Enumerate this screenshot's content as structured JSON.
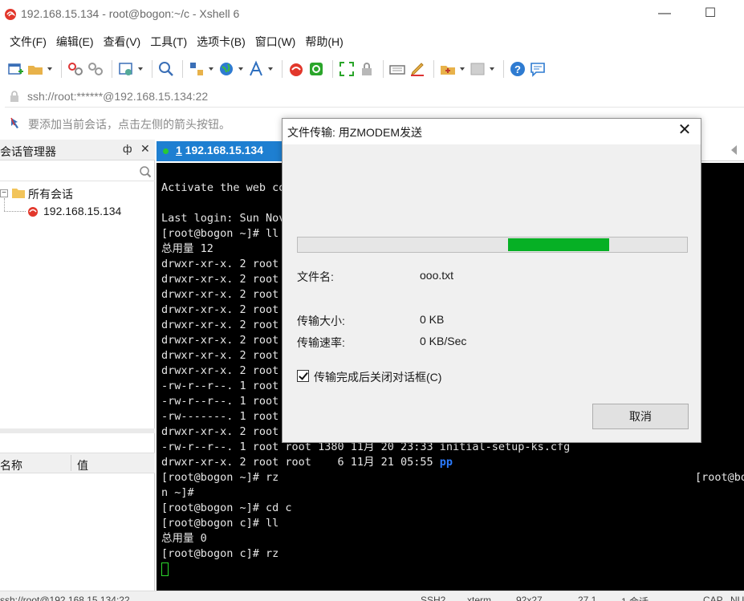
{
  "window": {
    "title": "192.168.15.134 - root@bogon:~/c - Xshell 6",
    "controls": {
      "minimize": "—",
      "maximize": "☐"
    }
  },
  "menu": [
    "文件(F)",
    "编辑(E)",
    "查看(V)",
    "工具(T)",
    "选项卡(B)",
    "窗口(W)",
    "帮助(H)"
  ],
  "toolbar_icons": [
    "new-session-icon",
    "open-folder-icon",
    "reconnect-icon",
    "disconnect-icon",
    "properties-icon",
    "find-icon",
    "transfer-icon",
    "globe-icon",
    "font-icon",
    "xftp-icon",
    "xmanager-icon",
    "fullscreen-icon",
    "lock-icon",
    "keyboard-icon",
    "highlight-icon",
    "new-tab-icon",
    "layout-icon",
    "help-icon",
    "chat-icon"
  ],
  "address": {
    "text": "ssh://root:******@192.168.15.134:22"
  },
  "hint": {
    "text": "要添加当前会话，点击左侧的箭头按钮。"
  },
  "session_manager": {
    "title": "会话管理器",
    "pin": "ф",
    "close": "✕",
    "folder": {
      "expander": "−",
      "label": "所有会话"
    },
    "session": {
      "label": "192.168.15.134"
    },
    "properties": {
      "col_name": "名称",
      "col_value": "值"
    }
  },
  "tab": {
    "number": "1",
    "label": " 192.168.15.134"
  },
  "terminal": {
    "lines": [
      "Activate the web co",
      "",
      "Last login: Sun Nov",
      "[root@bogon ~]# ll",
      "总用量 12",
      "drwxr-xr-x. 2 root",
      "drwxr-xr-x. 2 root",
      "drwxr-xr-x. 2 root",
      "drwxr-xr-x. 2 root",
      "drwxr-xr-x. 2 root",
      "drwxr-xr-x. 2 root",
      "drwxr-xr-x. 2 root",
      "drwxr-xr-x. 2 root",
      "-rw-r--r--. 1 root",
      "-rw-r--r--. 1 root",
      "-rw-------. 1 root",
      "drwxr-xr-x. 2 root",
      "-rw-r--r--. 1 root root 1380 11月 20 23:33 initial-setup-ks.cfg",
      "drwxr-xr-x. 2 root root    6 11月 21 05:55 ",
      "[root@bogon ~]# rz",
      "n ~]#",
      "[root@bogon ~]# cd c",
      "[root@bogon c]# ll",
      "总用量 0",
      "[root@bogon c]# rz"
    ],
    "dir_name": "pp",
    "right_fragment": "[root@bo"
  },
  "statusbar": {
    "left": "ssh://root@192.168.15.134:22",
    "ssh": "SSH2",
    "term": "xterm",
    "size": "92x27",
    "pos": "27,1",
    "sessions": "1 会话",
    "caps": "CAP",
    "num": "NUM"
  },
  "dialog": {
    "title": "文件传输: 用ZMODEM发送",
    "close": "✕",
    "progress_start": 0.54,
    "progress_end": 0.8,
    "filename_label": "文件名:",
    "filename_value": "ooo.txt",
    "size_label": "传输大小:",
    "size_value": "0 KB",
    "rate_label": "传输速率:",
    "rate_value": "0 KB/Sec",
    "close_on_finish_label": "传输完成后关闭对话框(C)",
    "close_on_finish_checked": true,
    "cancel_label": "取消"
  },
  "colors": {
    "tab_active": "#1e7fd1",
    "progress_fill": "#06b025",
    "terminal_bg": "#000000",
    "dir_color": "#2b7bff"
  }
}
